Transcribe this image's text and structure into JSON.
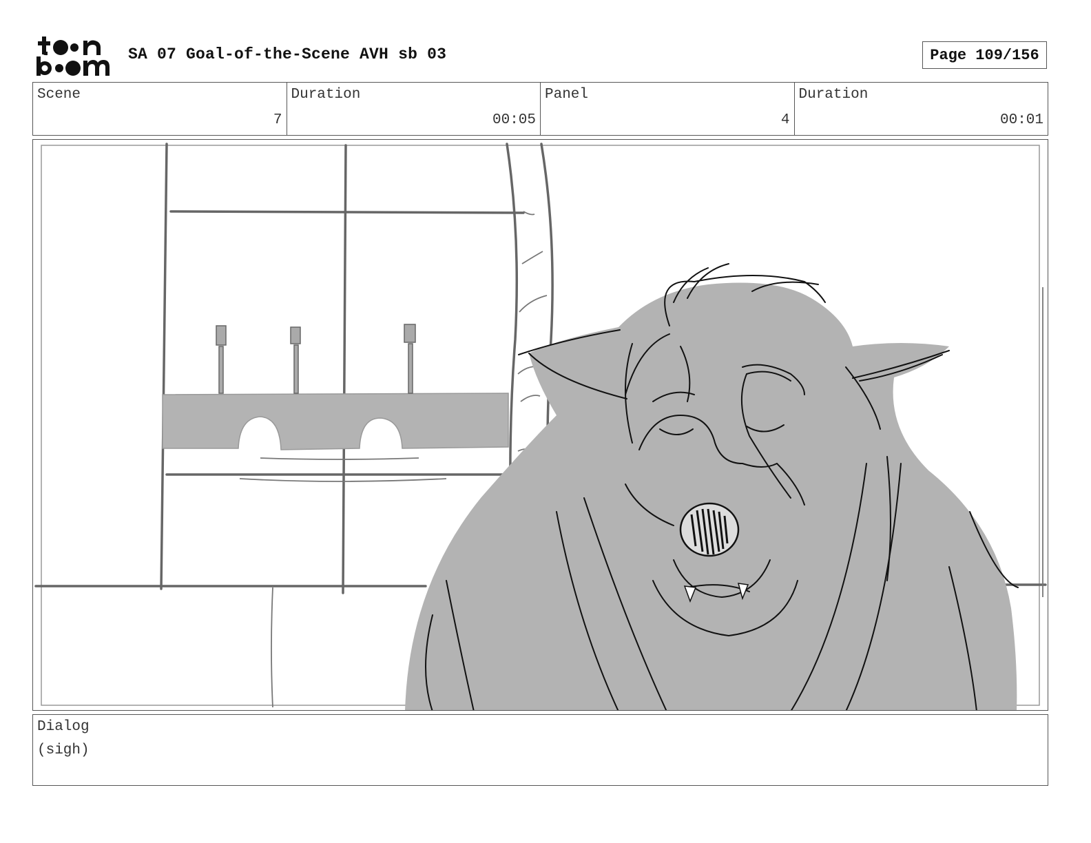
{
  "header": {
    "logo_text": "toon boom",
    "title": "SA 07 Goal-of-the-Scene AVH sb 03",
    "page_label": "Page 109/156"
  },
  "info": {
    "scene_label": "Scene",
    "scene_value": "7",
    "scene_duration_label": "Duration",
    "scene_duration_value": "00:05",
    "panel_label": "Panel",
    "panel_value": "4",
    "panel_duration_label": "Duration",
    "panel_duration_value": "00:01"
  },
  "dialog": {
    "label": "Dialog",
    "text": "(sigh)"
  }
}
